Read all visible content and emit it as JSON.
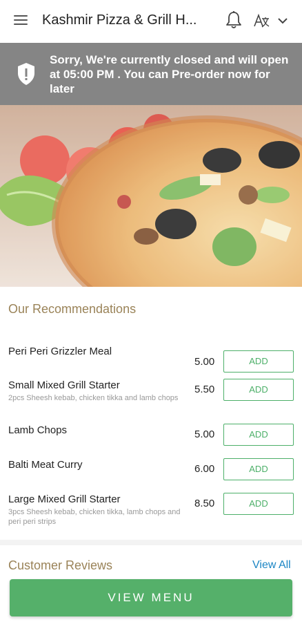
{
  "header": {
    "title": "Kashmir Pizza & Grill H...",
    "icons": [
      "menu-icon",
      "bell-icon",
      "language-icon",
      "chevron-down-icon"
    ]
  },
  "notice": {
    "message": "Sorry, We're currently closed and will open at 05:00 PM . You can Pre-order now for later",
    "icon": "shield-alert-icon"
  },
  "recommendations": {
    "title": "Our Recommendations",
    "items": [
      {
        "name": "Peri Peri Grizzler Meal",
        "description": "",
        "price": "5.00",
        "button": "ADD"
      },
      {
        "name": "Small Mixed Grill Starter",
        "description": "2pcs Sheesh kebab, chicken tikka and lamb chops",
        "price": "5.50",
        "button": "ADD"
      },
      {
        "name": "Lamb Chops",
        "description": "",
        "price": "5.00",
        "button": "ADD"
      },
      {
        "name": "Balti Meat Curry",
        "description": "",
        "price": "6.00",
        "button": "ADD"
      },
      {
        "name": "Large Mixed Grill Starter",
        "description": "3pcs Sheesh kebab, chicken tikka, lamb chops and peri peri strips",
        "price": "8.50",
        "button": "ADD"
      }
    ]
  },
  "reviews": {
    "title": "Customer Reviews",
    "view_all": "View All"
  },
  "footer": {
    "view_menu": "VIEW MENU"
  },
  "colors": {
    "accent_green": "#55b06a",
    "section_title": "#9a8358",
    "link_blue": "#1b85c4",
    "notice_bg": "#858585"
  }
}
